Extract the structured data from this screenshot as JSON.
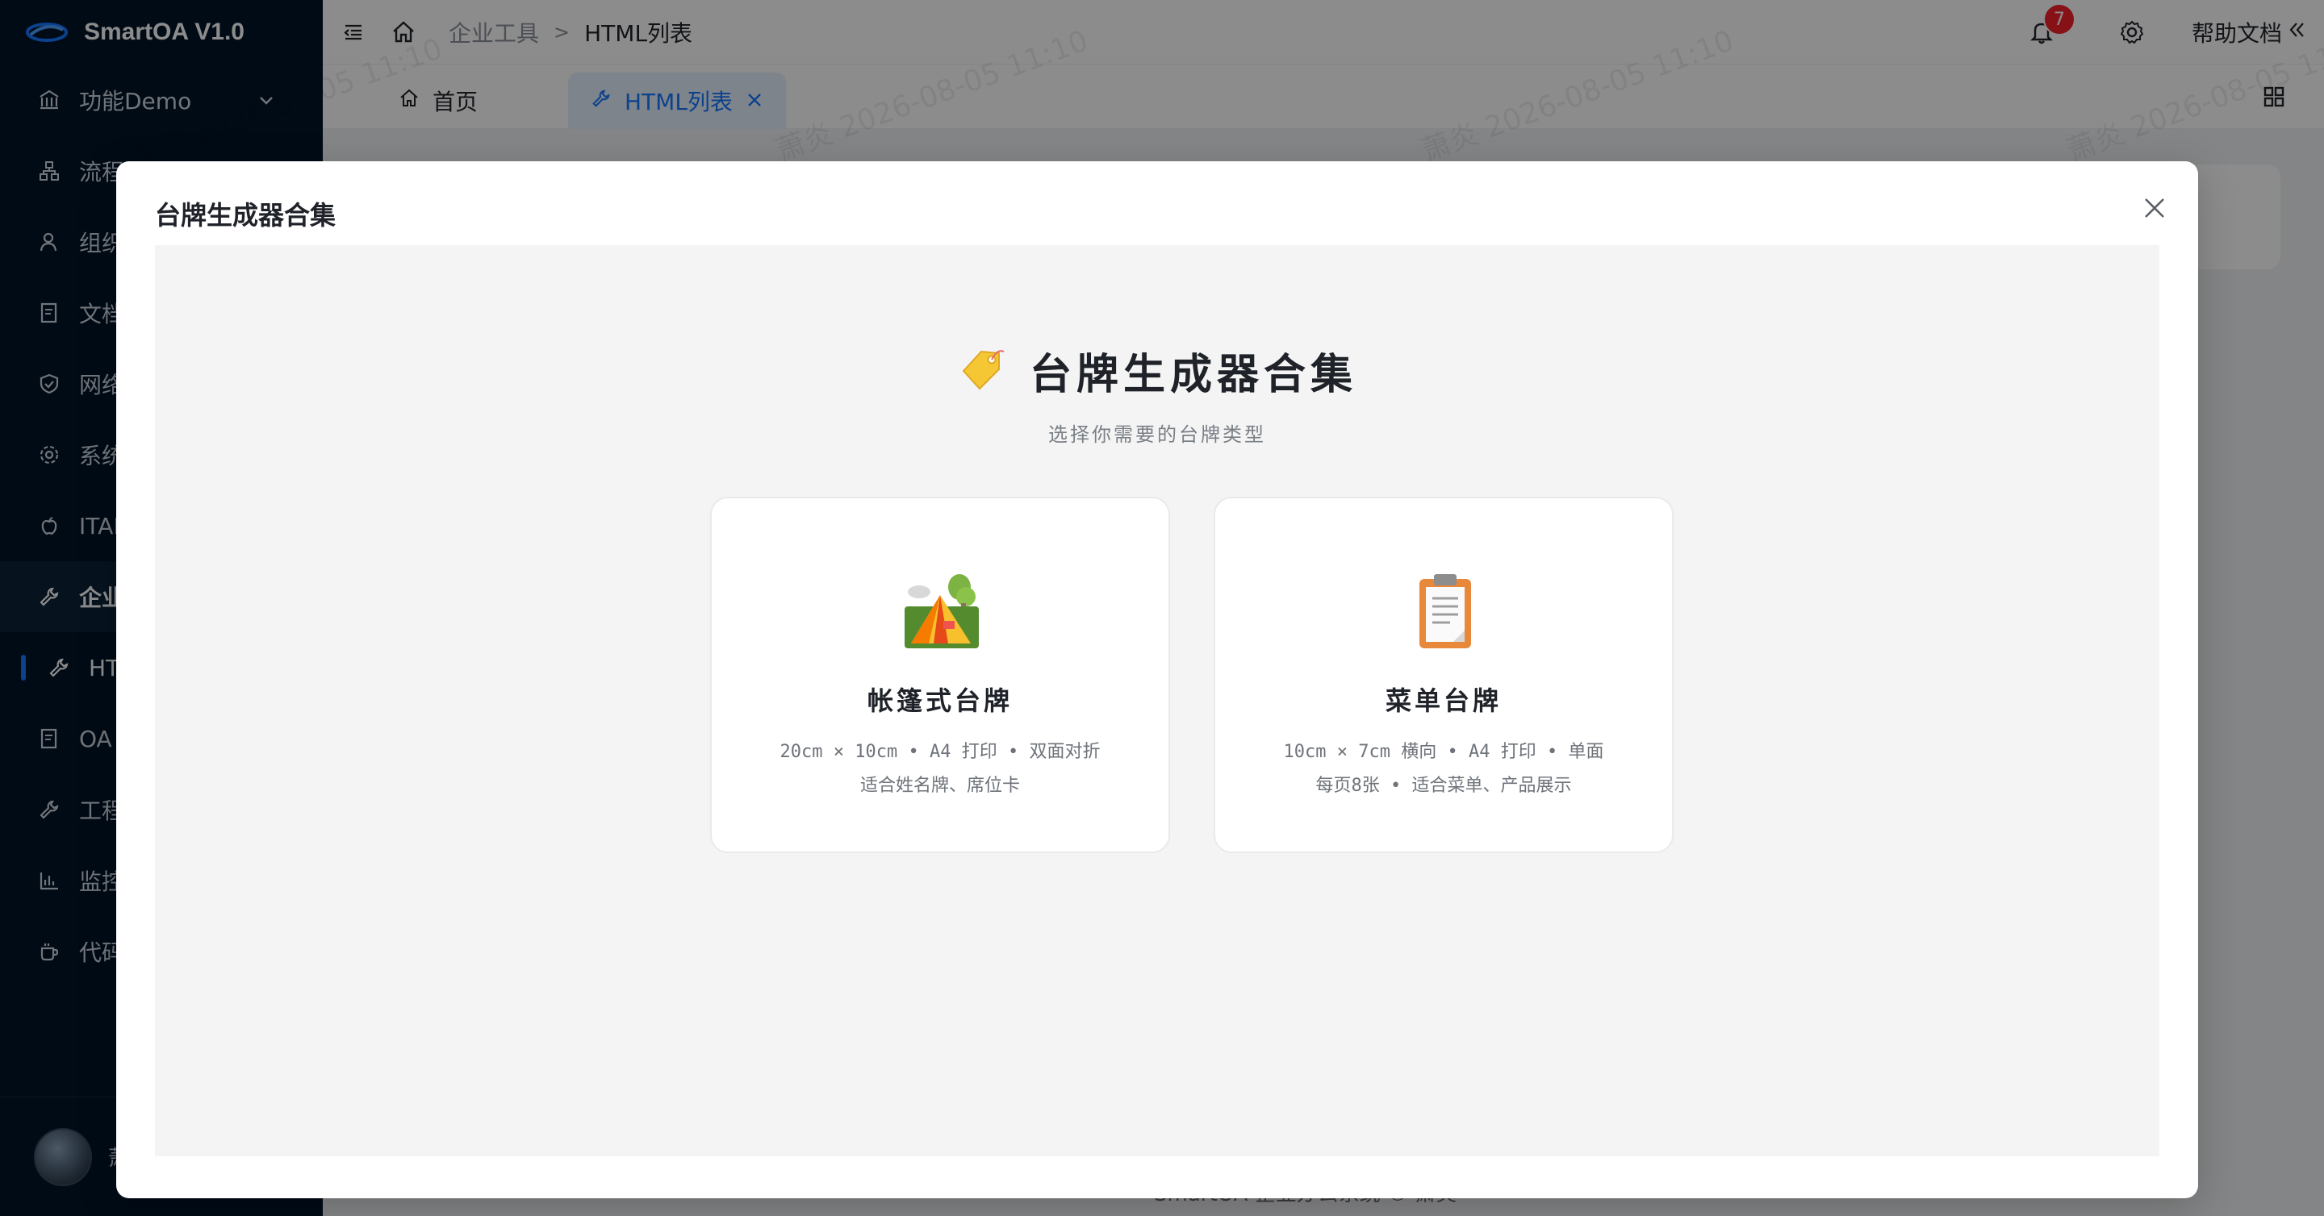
{
  "app": {
    "title": "SmartOA V1.0",
    "brand_color": "#1677ff"
  },
  "sidebar": {
    "items": [
      {
        "label": "功能Demo",
        "icon": "bank-icon"
      },
      {
        "label": "流程",
        "icon": "flow-icon"
      },
      {
        "label": "组织",
        "icon": "user-icon"
      },
      {
        "label": "文档",
        "icon": "document-icon"
      },
      {
        "label": "网络",
        "icon": "shield-icon"
      },
      {
        "label": "系统",
        "icon": "gear-icon"
      },
      {
        "label": "ITAM",
        "icon": "apple-icon"
      },
      {
        "label": "企业",
        "icon": "wrench-icon"
      },
      {
        "label": "HT",
        "icon": "wrench-icon"
      },
      {
        "label": "OA",
        "icon": "document-icon"
      },
      {
        "label": "工程",
        "icon": "wrench-icon"
      },
      {
        "label": "监控",
        "icon": "chart-icon"
      },
      {
        "label": "代码",
        "icon": "cup-icon"
      }
    ],
    "user": {
      "name": "萧"
    }
  },
  "header": {
    "breadcrumb": {
      "parent": "企业工具",
      "separator": ">",
      "current": "HTML列表"
    },
    "notification_count": "7",
    "help_label": "帮助文档"
  },
  "tabs": [
    {
      "label": "首页"
    },
    {
      "label": "HTML列表"
    }
  ],
  "watermark": "萧炎 2026-08-05 11:10",
  "footer": {
    "text": "SmartOA 企业办公系统 © 萧炎"
  },
  "modal": {
    "title": "台牌生成器合集",
    "hero_title": "台牌生成器合集",
    "hero_subtitle": "选择你需要的台牌类型",
    "cards": [
      {
        "title": "帐篷式台牌",
        "desc_line1": "20cm × 10cm • A4 打印 • 双面对折",
        "desc_line2": "适合姓名牌、席位卡",
        "icon": "tent-icon"
      },
      {
        "title": "菜单台牌",
        "desc_line1": "10cm × 7cm 横向 • A4 打印 • 单面",
        "desc_line2": "每页8张 • 适合菜单、产品展示",
        "icon": "clipboard-icon"
      }
    ]
  }
}
